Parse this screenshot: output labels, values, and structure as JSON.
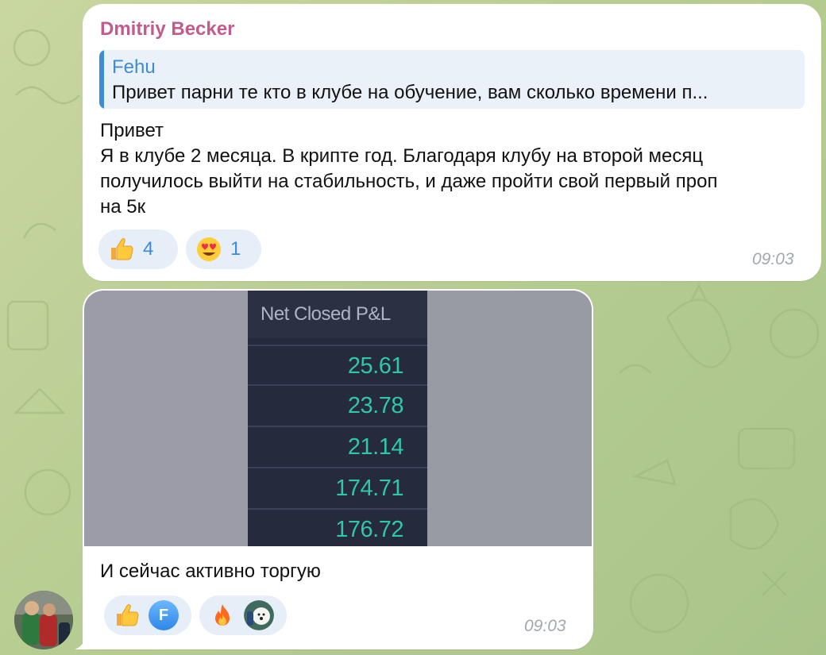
{
  "message1": {
    "sender": "Dmitriy Becker",
    "reply": {
      "author": "Fehu",
      "text": "Привет парни те кто в клубе на обучение, вам сколько времени п..."
    },
    "lines": [
      "Привет",
      "Я в клубе 2 месяца. В крипте год. Благодаря клубу на второй месяц",
      "получилось выйти на стабильность, и даже пройти свой первый проп",
      "на 5к"
    ],
    "reactions": [
      {
        "icon": "thumbs-up-emoji",
        "count": "4"
      },
      {
        "icon": "heart-eyes-emoji",
        "count": "1"
      }
    ],
    "time": "09:03"
  },
  "message2": {
    "image": {
      "header": "Net Closed P&L",
      "values": [
        "25.61",
        "23.78",
        "21.14",
        "174.71",
        "176.72"
      ]
    },
    "caption": "И сейчас активно торгую",
    "reactions": [
      {
        "icon": "thumbs-up-emoji",
        "user_badge": "F"
      },
      {
        "icon": "fire-emoji",
        "user_badge": "dog-avatar"
      }
    ],
    "time": "09:03"
  },
  "colors": {
    "sender": "#c35a8e",
    "accent": "#3e8bd6",
    "pnl_value": "#2fc8a6",
    "chat_bg": "#b7cd92"
  }
}
